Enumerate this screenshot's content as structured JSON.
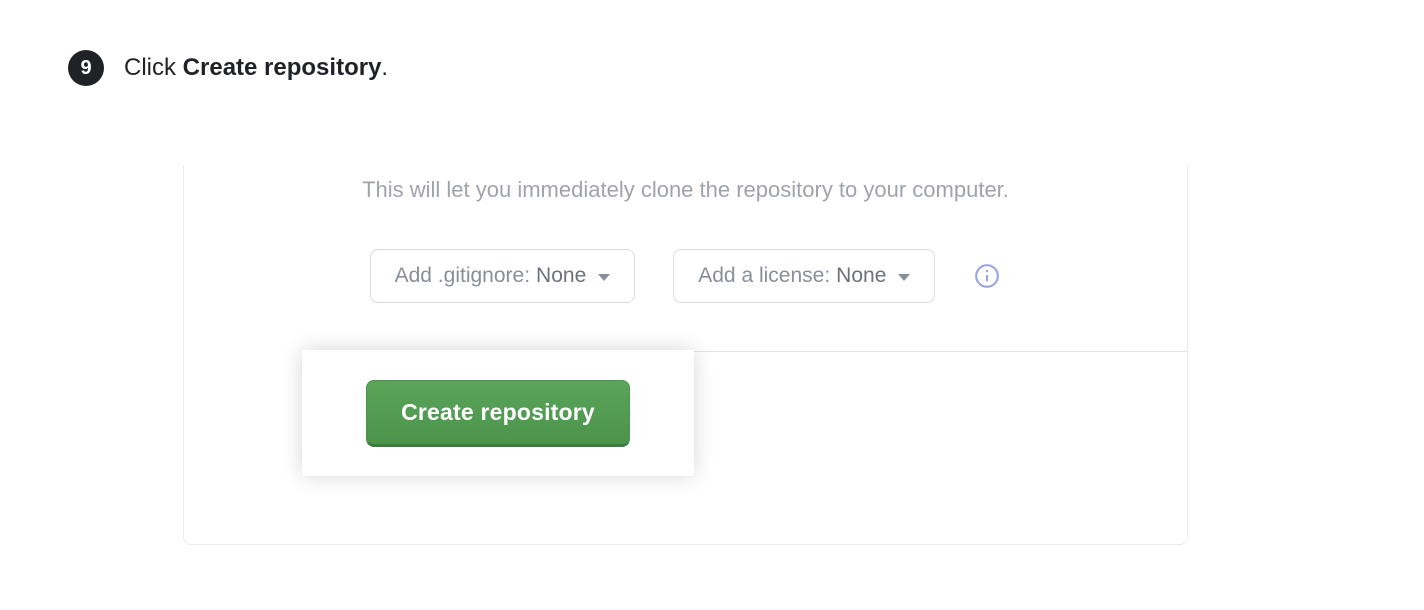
{
  "step": {
    "number": "9",
    "prefix": "Click ",
    "bold": "Create repository",
    "suffix": "."
  },
  "panel": {
    "description": "This will let you immediately clone the repository to your computer.",
    "gitignore": {
      "label": "Add .gitignore: ",
      "value": "None"
    },
    "license": {
      "label": "Add a license: ",
      "value": "None"
    },
    "create_button": "Create repository"
  }
}
